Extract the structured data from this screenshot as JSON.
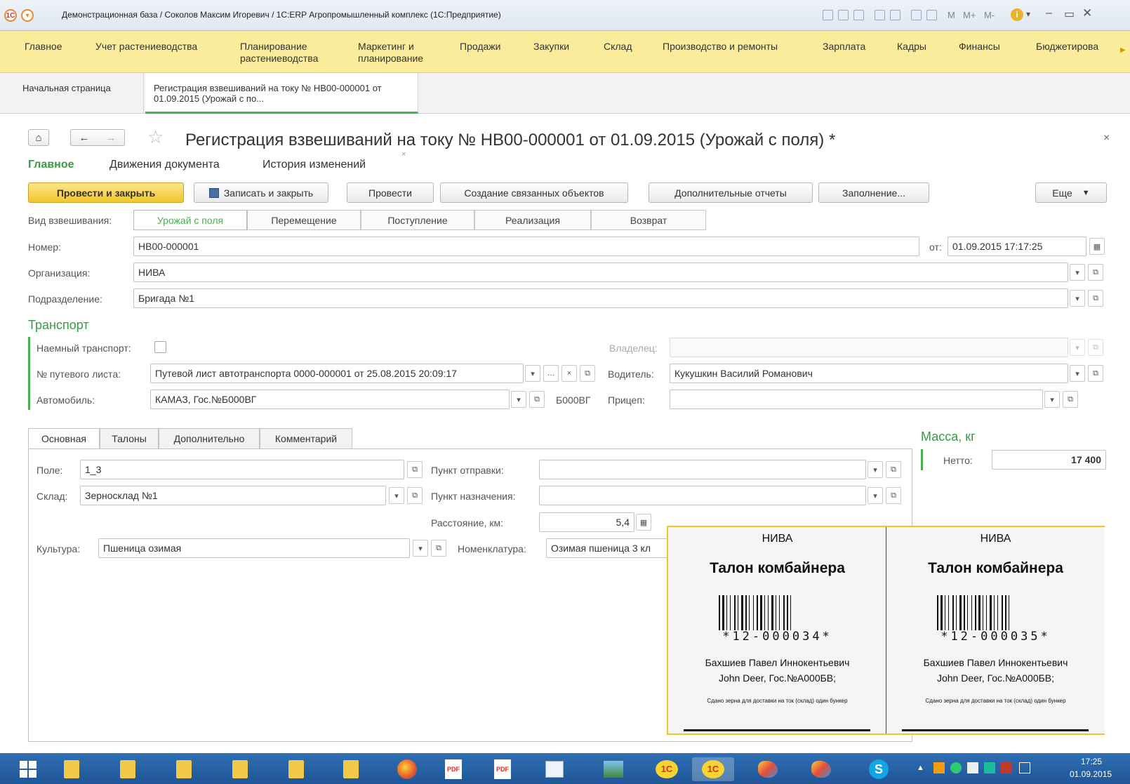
{
  "window": {
    "title": "Демонстрационная база / Соколов Максим Игоревич / 1С:ERP Агропромышленный комплекс  (1С:Предприятие)",
    "logo_text": "1C",
    "calc_buttons": [
      "M",
      "M+",
      "M-"
    ]
  },
  "sections": [
    {
      "label": "Главное"
    },
    {
      "label": "Учет растениеводства"
    },
    {
      "label": "Планирование растениеводства"
    },
    {
      "label": "Маркетинг и планирование"
    },
    {
      "label": "Продажи"
    },
    {
      "label": "Закупки"
    },
    {
      "label": "Склад"
    },
    {
      "label": "Производство и ремонты"
    },
    {
      "label": "Зарплата"
    },
    {
      "label": "Кадры"
    },
    {
      "label": "Финансы"
    },
    {
      "label": "Бюджетирова"
    }
  ],
  "open_tabs": [
    {
      "label": "Начальная страница"
    },
    {
      "label": "Регистрация взвешиваний на току № НВ00-000001 от 01.09.2015 (Урожай с по..."
    }
  ],
  "form": {
    "title": "Регистрация взвешиваний на току № НВ00-000001 от 01.09.2015 (Урожай с поля)  *",
    "subtabs": [
      "Главное",
      "Движения документа",
      "История изменений"
    ],
    "commands": {
      "post_close": "Провести и закрыть",
      "save_close": "Записать и закрыть",
      "post": "Провести",
      "create_linked": "Создание связанных объектов",
      "extra_reports": "Дополнительные отчеты",
      "fill": "Заполнение...",
      "more": "Еще"
    },
    "weighing_type_label": "Вид взвешивания:",
    "weighing_types": [
      "Урожай с поля",
      "Перемещение",
      "Поступление",
      "Реализация",
      "Возврат"
    ],
    "number_label": "Номер:",
    "number_value": "НВ00-000001",
    "date_label": "от:",
    "date_value": "01.09.2015 17:17:25",
    "org_label": "Организация:",
    "org_value": "НИВА",
    "dept_label": "Подразделение:",
    "dept_value": "Бригада №1"
  },
  "transport": {
    "title": "Транспорт",
    "hired_label": "Наемный транспорт:",
    "owner_label": "Владелец:",
    "waybill_label": "№ путевого листа:",
    "waybill_value": "Путевой лист автотранспорта 0000-000001 от 25.08.2015 20:09:17",
    "driver_label": "Водитель:",
    "driver_value": "Кукушкин Василий Романович",
    "car_label": "Автомобиль:",
    "car_value": "КАМАЗ, Гос.№Б000ВГ",
    "car_plate": "Б000ВГ",
    "trailer_label": "Прицеп:"
  },
  "mass": {
    "title": "Масса, кг",
    "net_label": "Нетто:",
    "net_value": "17 400"
  },
  "inner_tabs": [
    "Основная",
    "Талоны",
    "Дополнительно",
    "Комментарий"
  ],
  "main_tab": {
    "field_label": "Поле:",
    "field_value": "1_3",
    "warehouse_label": "Склад:",
    "warehouse_value": "Зерносклад №1",
    "origin_label": "Пункт отправки:",
    "dest_label": "Пункт назначения:",
    "distance_label": "Расстояние, км:",
    "distance_value": "5,4",
    "crop_label": "Культура:",
    "crop_value": "Пшеница озимая",
    "item_label": "Номенклатура:",
    "item_value": "Озимая пшеница 3 кл"
  },
  "coupons": [
    {
      "org": "НИВА",
      "title": "Талон комбайнера",
      "code": "*12-000034*",
      "person": "Бахшиев Павел Иннокентьевич",
      "vehicle": "John Deer, Гос.№А000БВ;",
      "note": "Сдано зерна для доставки на ток (склад) один бункер"
    },
    {
      "org": "НИВА",
      "title": "Талон комбайнера",
      "code": "*12-000035*",
      "person": "Бахшиев Павел Иннокентьевич",
      "vehicle": "John Deer, Гос.№А000БВ;",
      "note": "Сдано зерна для доставки на ток (склад) один бункер"
    }
  ],
  "taskbar": {
    "time": "17:25",
    "date": "01.09.2015",
    "pdf_label": "PDF",
    "app_1c_label": "1C",
    "skype_label": "S"
  },
  "colors": {
    "accent_green": "#4caf50",
    "menu_yellow": "#fbec9c",
    "default_button": "#f2c62d",
    "taskbar_blue": "#1f5596"
  }
}
